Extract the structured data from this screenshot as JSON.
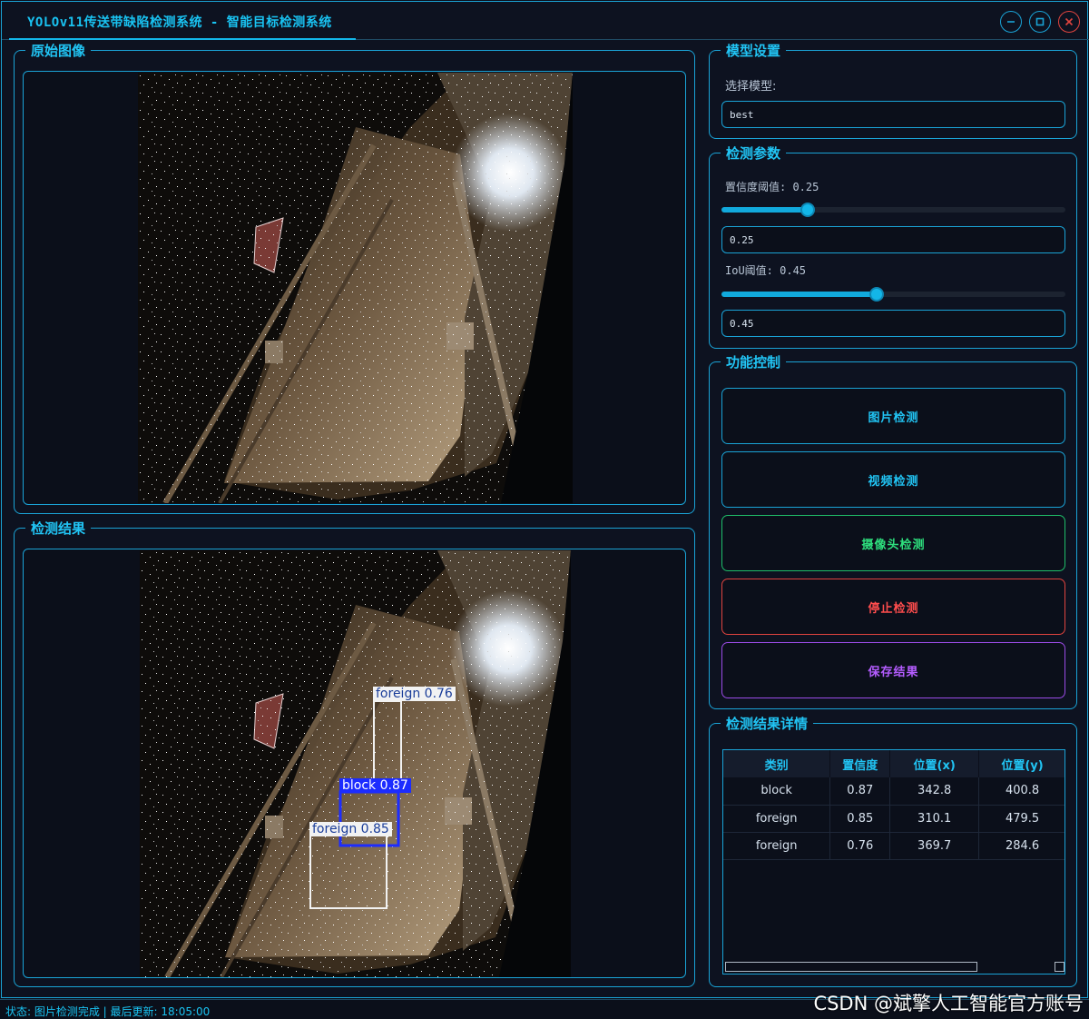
{
  "window": {
    "title": "YOLOv11传送带缺陷检测系统 - 智能目标检测系统",
    "buttons": [
      "minimize",
      "maximize",
      "close"
    ]
  },
  "original_panel": {
    "title": "原始图像"
  },
  "result_panel": {
    "title": "检测结果",
    "detections": [
      {
        "label": "foreign",
        "conf": "0.76",
        "color": "#f2f2f2"
      },
      {
        "label": "block",
        "conf": "0.87",
        "color": "#1c2cff"
      },
      {
        "label": "foreign",
        "conf": "0.85",
        "color": "#f2f2f2"
      }
    ]
  },
  "model_settings": {
    "title": "模型设置",
    "select_label": "选择模型:",
    "selected_model": "best"
  },
  "detect_params": {
    "title": "检测参数",
    "conf_label": "置信度阈值: 0.25",
    "conf_value": "0.25",
    "conf_fraction": 0.25,
    "iou_label": "IoU阈值: 0.45",
    "iou_value": "0.45",
    "iou_fraction": 0.45
  },
  "controls": {
    "title": "功能控制",
    "buttons": [
      {
        "label": "图片检测",
        "color": "#21c4f4",
        "border": "#1aa3d6"
      },
      {
        "label": "视频检测",
        "color": "#21c4f4",
        "border": "#1aa3d6"
      },
      {
        "label": "摄像头检测",
        "color": "#2ee07e",
        "border": "#1fbf6a"
      },
      {
        "label": "停止检测",
        "color": "#ff4d4d",
        "border": "#e0443f"
      },
      {
        "label": "保存结果",
        "color": "#b45cff",
        "border": "#9b4be6"
      }
    ]
  },
  "details": {
    "title": "检测结果详情",
    "columns": [
      "类别",
      "置信度",
      "位置(x)",
      "位置(y)"
    ],
    "rows": [
      [
        "block",
        "0.87",
        "342.8",
        "400.8"
      ],
      [
        "foreign",
        "0.85",
        "310.1",
        "479.5"
      ],
      [
        "foreign",
        "0.76",
        "369.7",
        "284.6"
      ]
    ]
  },
  "status": {
    "text": "状态: 图片检测完成 | 最后更新: 18:05:00",
    "watermark": "CSDN @斌擎人工智能官方账号"
  }
}
